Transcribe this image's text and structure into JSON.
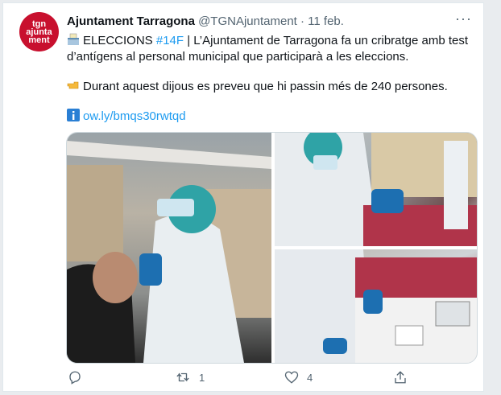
{
  "tweet": {
    "avatar_text": "tgn\najunta\nment",
    "author_name": "Ajuntament Tarragona",
    "handle_date": "@TGNAjuntament · 11 feb.",
    "more": "···",
    "line1_a": "ELECCIONS ",
    "line1_hashtag": "#14F",
    "line1_b": " | L’Ajuntament de Tarragona fa un cribratge amb test d’antígens al personal municipal que participarà a les eleccions.",
    "line2": "Durant aquest dijous es preveu que hi passin més de 240 persones.",
    "link": "ow.ly/bmqs30rwtqd",
    "retweet_count": "1",
    "like_count": "4"
  },
  "icons": [
    "ballot-box-icon",
    "pointing-hand-icon",
    "info-icon",
    "reply-icon",
    "retweet-icon",
    "like-icon",
    "share-icon"
  ]
}
